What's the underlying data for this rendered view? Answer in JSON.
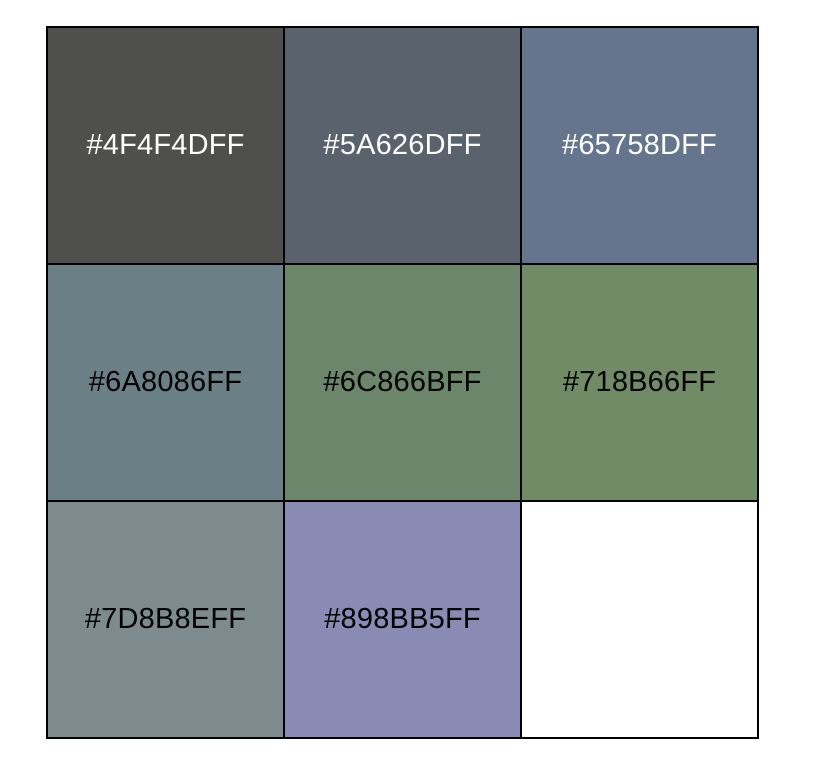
{
  "swatches": [
    {
      "label": "#4F4F4DFF",
      "color": "#4F4F4D",
      "text_color": "#FFFFFF"
    },
    {
      "label": "#5A626DFF",
      "color": "#5A626D",
      "text_color": "#FFFFFF"
    },
    {
      "label": "#65758DFF",
      "color": "#65758D",
      "text_color": "#FFFFFF"
    },
    {
      "label": "#6A8086FF",
      "color": "#6A8086",
      "text_color": "#000000"
    },
    {
      "label": "#6C866BFF",
      "color": "#6C866B",
      "text_color": "#000000"
    },
    {
      "label": "#718B66FF",
      "color": "#718B66",
      "text_color": "#000000"
    },
    {
      "label": "#7D8B8EFF",
      "color": "#7D8B8E",
      "text_color": "#000000"
    },
    {
      "label": "#898BB5FF",
      "color": "#898BB5",
      "text_color": "#000000"
    }
  ]
}
